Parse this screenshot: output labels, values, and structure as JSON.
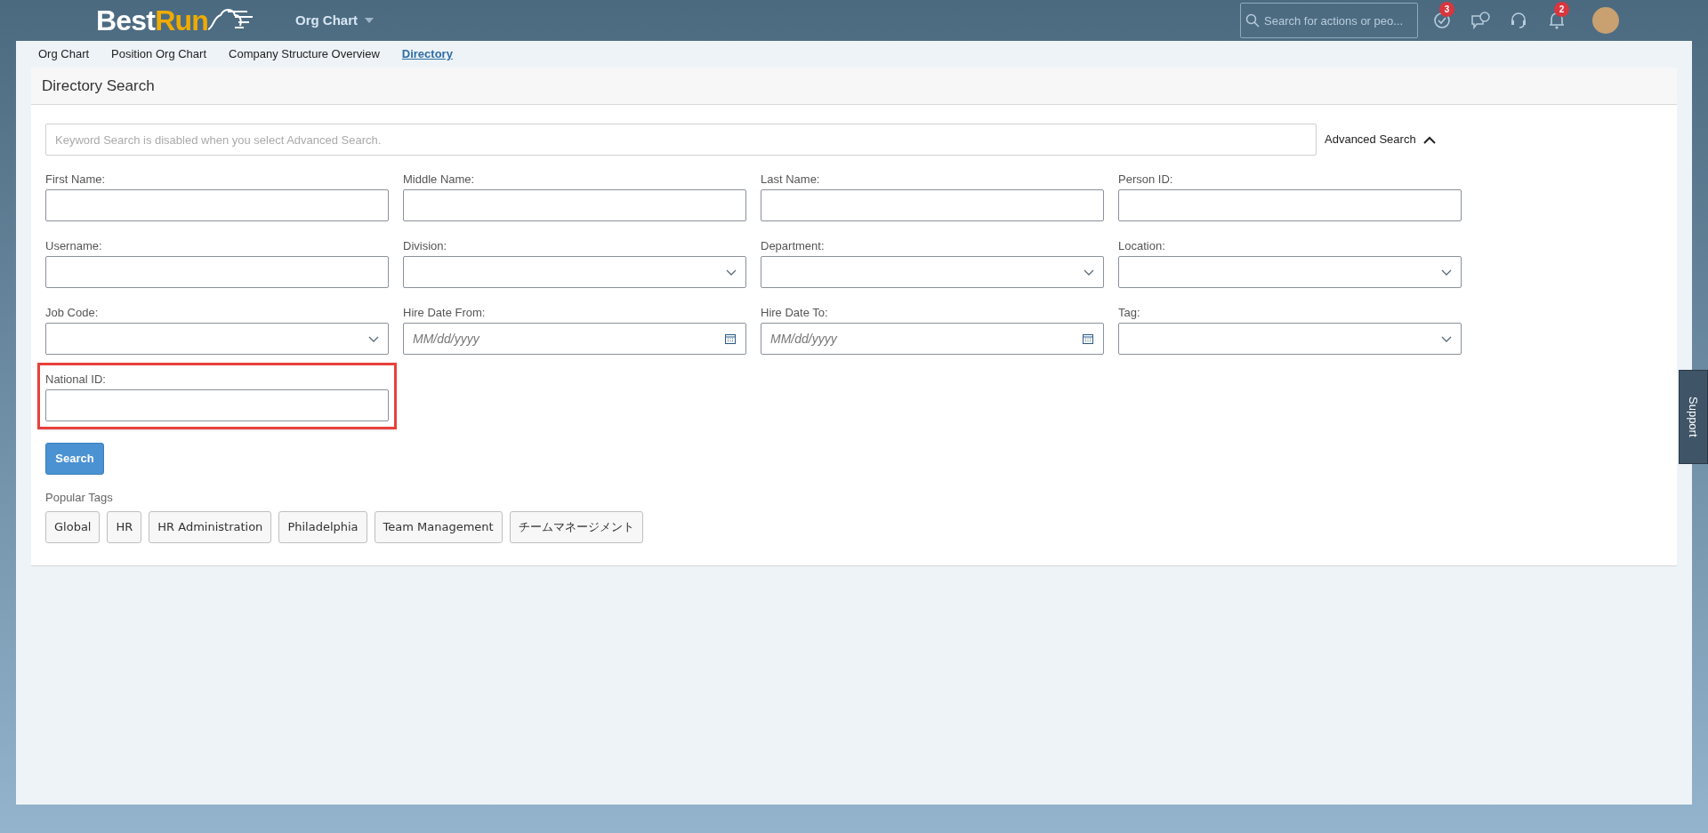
{
  "header": {
    "logo": {
      "primary": "Best",
      "accent": "Run"
    },
    "app_menu": "Org Chart",
    "search": {
      "placeholder": "Search for actions or peo..."
    },
    "icons": [
      {
        "kind": "todo",
        "badge": "3"
      },
      {
        "kind": "feedback"
      },
      {
        "kind": "support"
      },
      {
        "kind": "notifications",
        "badge": "2"
      },
      {
        "kind": "avatar"
      }
    ]
  },
  "tabs": [
    {
      "label": "Org Chart",
      "selected": false
    },
    {
      "label": "Position Org Chart",
      "selected": false
    },
    {
      "label": "Company Structure Overview",
      "selected": false
    },
    {
      "label": "Directory",
      "selected": true
    }
  ],
  "page_title": "Directory Search",
  "keyword_search": {
    "placeholder": "Keyword Search is disabled when you select Advanced Search."
  },
  "advanced_search": {
    "label": "Advanced Search",
    "expanded": true
  },
  "fields": [
    {
      "label": "First Name:",
      "kind": "text",
      "highlighted": false
    },
    {
      "label": "Middle Name:",
      "kind": "text",
      "highlighted": false
    },
    {
      "label": "Last Name:",
      "kind": "text",
      "highlighted": false
    },
    {
      "label": "Person ID:",
      "kind": "text",
      "highlighted": false
    },
    {
      "label": "Username:",
      "kind": "text",
      "highlighted": false
    },
    {
      "label": "Division:",
      "kind": "select",
      "highlighted": false
    },
    {
      "label": "Department:",
      "kind": "select",
      "highlighted": false
    },
    {
      "label": "Location:",
      "kind": "select",
      "highlighted": false
    },
    {
      "label": "Job Code:",
      "kind": "select",
      "highlighted": false
    },
    {
      "label": "Hire Date From:",
      "kind": "date",
      "placeholder": "MM/dd/yyyy",
      "highlighted": false
    },
    {
      "label": "Hire Date To:",
      "kind": "date",
      "placeholder": "MM/dd/yyyy",
      "highlighted": false
    },
    {
      "label": "Tag:",
      "kind": "select",
      "highlighted": false
    },
    {
      "label": "National ID:",
      "kind": "text",
      "highlighted": true
    }
  ],
  "search_button": "Search",
  "popular_tags": {
    "title": "Popular Tags",
    "tags": [
      "Global",
      "HR",
      "HR Administration",
      "Philadelphia",
      "Team Management",
      "チームマネージメント"
    ]
  },
  "support_tab": "Support"
}
